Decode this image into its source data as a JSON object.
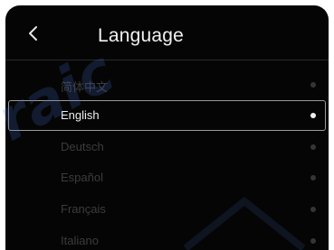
{
  "header": {
    "back_icon": "chevron-left-icon",
    "title": "Language"
  },
  "languages": [
    {
      "label": "简体中文",
      "selected": false
    },
    {
      "label": "English",
      "selected": true
    },
    {
      "label": "Deutsch",
      "selected": false
    },
    {
      "label": "Español",
      "selected": false
    },
    {
      "label": "Français",
      "selected": false
    },
    {
      "label": "Italiano",
      "selected": false
    }
  ],
  "watermark": {
    "text": "raic"
  },
  "colors": {
    "background": "#050505",
    "selected_text": "#efefef",
    "unselected_text": "#3c3c3c",
    "selection_border": "#9a9a9a",
    "watermark": "#466ec8"
  }
}
